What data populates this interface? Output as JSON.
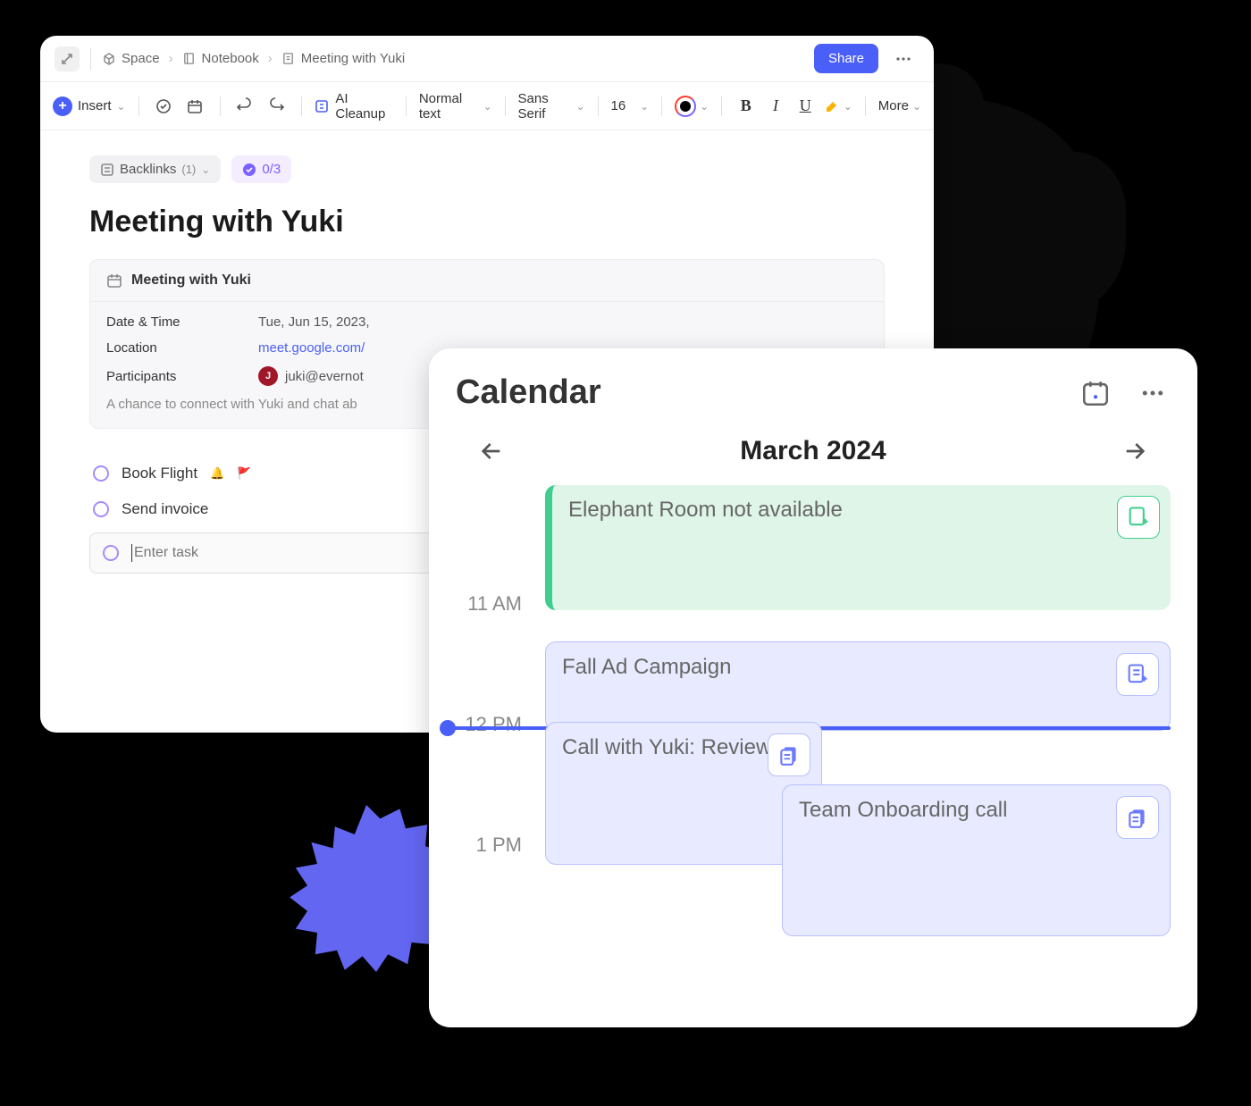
{
  "breadcrumb": {
    "space": "Space",
    "notebook": "Notebook",
    "page": "Meeting with Yuki"
  },
  "header": {
    "share": "Share"
  },
  "toolbar": {
    "insert": "Insert",
    "ai_cleanup": "AI Cleanup",
    "text_style": "Normal text",
    "font_family": "Sans Serif",
    "font_size": "16",
    "more": "More"
  },
  "pills": {
    "backlinks_label": "Backlinks",
    "backlinks_count": "(1)",
    "tasks_count": "0/3"
  },
  "doc": {
    "title": "Meeting with Yuki"
  },
  "info_card": {
    "title": "Meeting with Yuki",
    "rows": {
      "datetime_label": "Date & Time",
      "datetime_value": "Tue, Jun 15, 2023,",
      "location_label": "Location",
      "location_value": "meet.google.com/",
      "participants_label": "Participants",
      "participants_value": "juki@evernot",
      "participant_initial": "J"
    },
    "description": "A chance to connect with Yuki and chat ab"
  },
  "tasks": {
    "items": [
      {
        "label": "Book Flight",
        "has_bell": true,
        "has_flag": true
      },
      {
        "label": "Send invoice",
        "has_bell": false,
        "has_flag": false
      }
    ],
    "input_placeholder": "Enter task"
  },
  "calendar": {
    "title": "Calendar",
    "month": "March 2024",
    "times": {
      "t11": "11 AM",
      "t12": "12 PM",
      "t13": "1 PM"
    },
    "events": {
      "elephant": "Elephant Room not available",
      "fall": "Fall Ad Campaign",
      "yuki": "Call with Yuki: Review",
      "onboarding": "Team Onboarding call"
    }
  }
}
